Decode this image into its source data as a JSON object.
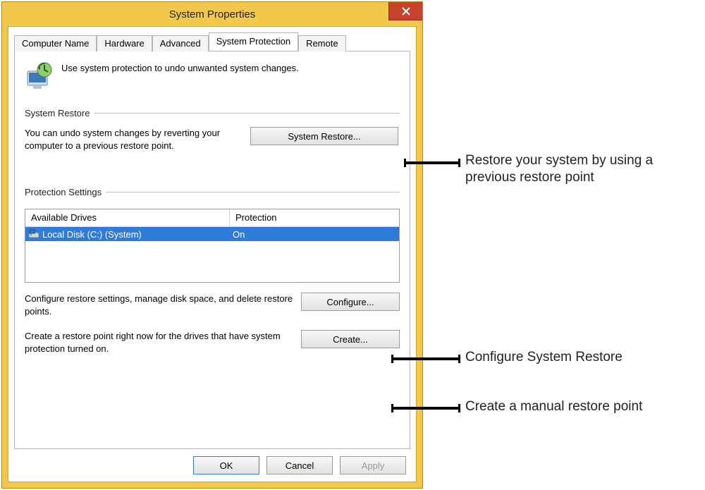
{
  "window": {
    "title": "System Properties"
  },
  "tabs": {
    "items": [
      "Computer Name",
      "Hardware",
      "Advanced",
      "System Protection",
      "Remote"
    ],
    "active_index": 3
  },
  "intro": {
    "text": "Use system protection to undo unwanted system changes."
  },
  "groups": {
    "restore": {
      "title": "System Restore",
      "desc": "You can undo system changes by reverting your computer to a previous restore point.",
      "button": "System Restore..."
    },
    "protection": {
      "title": "Protection Settings",
      "columns": {
        "drive": "Available Drives",
        "prot": "Protection"
      },
      "rows": [
        {
          "drive": "Local Disk (C:) (System)",
          "prot": "On"
        }
      ],
      "configure": {
        "desc": "Configure restore settings, manage disk space, and delete restore points.",
        "button": "Configure..."
      },
      "create": {
        "desc": "Create a restore point right now for the drives that have system protection turned on.",
        "button": "Create..."
      }
    }
  },
  "footer": {
    "ok": "OK",
    "cancel": "Cancel",
    "apply": "Apply"
  },
  "callouts": {
    "restore": "Restore your system by using a previous restore point",
    "configure": "Configure System Restore",
    "create": "Create a manual restore point"
  }
}
